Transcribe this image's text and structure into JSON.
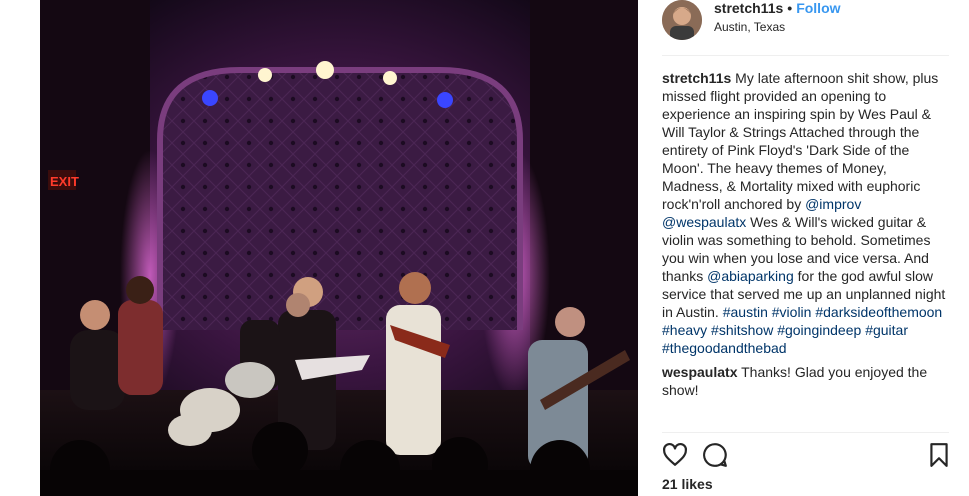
{
  "post": {
    "username": "stretch11s",
    "follow_label": "Follow",
    "location": "Austin, Texas",
    "photo_alt": "band on stage",
    "exit_sign": "EXIT"
  },
  "caption": {
    "author": "stretch11s",
    "text_1": "My late afternoon shit show, plus missed flight provided an opening to experience an inspiring spin by Wes Paul & Will Taylor & Strings Attached through the entirety of Pink Floyd's 'Dark Side of the Moon'. The heavy themes of Money, Madness, & Mortality mixed with euphoric rock'n'roll anchored by",
    "mention_1": "@improv",
    "mention_2": "@wespaulatx",
    "text_2": "Wes & Will's wicked guitar & violin was something to behold. Sometimes you win when you lose and vice versa. And thanks",
    "mention_3": "@abiaparking",
    "text_3": "for the god awful slow service that served me up an unplanned night in Austin.",
    "tags": [
      "#austin",
      "#violin",
      "#darksideofthemoon",
      "#heavy",
      "#shitshow",
      "#goingindeep",
      "#guitar",
      "#thegoodandthebad"
    ]
  },
  "comment": {
    "author": "wespaulatx",
    "text": "Thanks! Glad you enjoyed the show!"
  },
  "actions": {
    "likes": "21 likes",
    "icons": [
      "heart-icon",
      "comment-icon",
      "bookmark-icon"
    ]
  }
}
